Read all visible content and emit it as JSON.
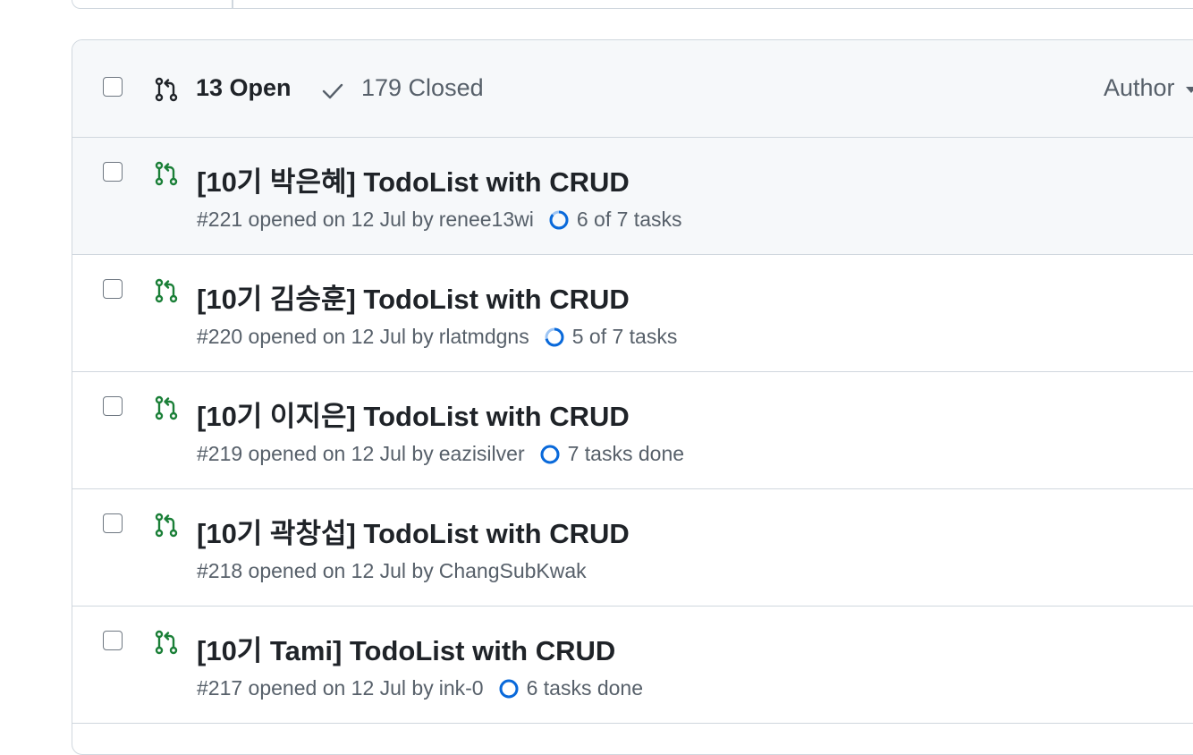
{
  "colors": {
    "open_green": "#1a7f37",
    "progress_blue": "#0969da",
    "progress_track": "#9ec5f4",
    "border": "#d0d7de",
    "header_bg": "#f6f8fa",
    "muted_text": "#57606a"
  },
  "header": {
    "open_icon": "git-pull-request-icon",
    "open_label": "13 Open",
    "closed_icon": "check-icon",
    "closed_label": "179 Closed",
    "author_label": "Author",
    "author_icon": "triangle-down-icon"
  },
  "pull_requests": [
    {
      "title": "[10기 박은혜] TodoList with CRUD",
      "meta_prefix": "#221 opened on 12 Jul by",
      "author": "renee13wi",
      "progress_label": "6 of 7 tasks",
      "progress_fraction": 0.857
    },
    {
      "title": "[10기 김승훈] TodoList with CRUD",
      "meta_prefix": "#220 opened on 12 Jul by",
      "author": "rlatmdgns",
      "progress_label": "5 of 7 tasks",
      "progress_fraction": 0.714
    },
    {
      "title": "[10기 이지은] TodoList with CRUD",
      "meta_prefix": "#219 opened on 12 Jul by",
      "author": "eazisilver",
      "progress_label": "7 tasks done",
      "progress_fraction": 1
    },
    {
      "title": "[10기 곽창섭] TodoList with CRUD",
      "meta_prefix": "#218 opened on 12 Jul by",
      "author": "ChangSubKwak",
      "progress_label": "",
      "progress_fraction": null
    },
    {
      "title": "[10기 Tami] TodoList with CRUD",
      "meta_prefix": "#217 opened on 12 Jul by",
      "author": "ink-0",
      "progress_label": "6 tasks done",
      "progress_fraction": 1
    }
  ]
}
